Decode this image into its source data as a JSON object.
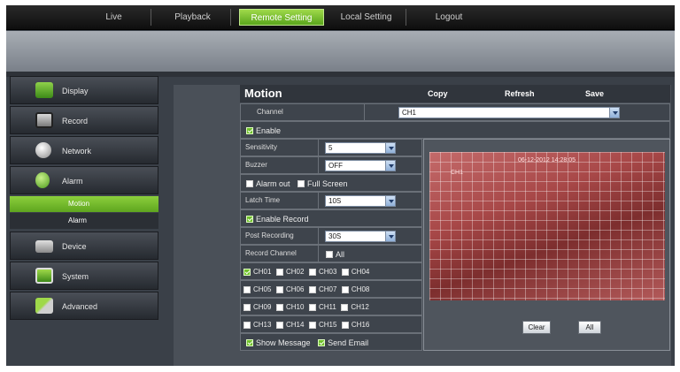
{
  "topbar": {
    "tabs": [
      {
        "label": "Live",
        "active": false
      },
      {
        "label": "Playback",
        "active": false
      },
      {
        "label": "Remote Setting",
        "active": true
      },
      {
        "label": "Local Setting",
        "active": false
      },
      {
        "label": "Logout",
        "active": false
      }
    ]
  },
  "sidebar": {
    "items": [
      {
        "label": "Display",
        "icon": "monitor-icon"
      },
      {
        "label": "Record",
        "icon": "film-icon"
      },
      {
        "label": "Network",
        "icon": "globe-icon"
      },
      {
        "label": "Alarm",
        "icon": "alarm-icon"
      },
      {
        "label": "Device",
        "icon": "hdd-icon"
      },
      {
        "label": "System",
        "icon": "system-icon"
      },
      {
        "label": "Advanced",
        "icon": "tools-icon"
      }
    ],
    "alarm_subitems": [
      {
        "label": "Motion",
        "active": true
      },
      {
        "label": "Alarm",
        "active": false
      }
    ]
  },
  "header": {
    "title": "Motion",
    "copy": "Copy",
    "refresh": "Refresh",
    "save": "Save"
  },
  "form": {
    "channel_label": "Channel",
    "channel_value": "CH1",
    "enable_label": "Enable",
    "enable_checked": true,
    "sensitivity_label": "Sensitivity",
    "sensitivity_value": "5",
    "buzzer_label": "Buzzer",
    "buzzer_value": "OFF",
    "alarm_out_label": "Alarm out",
    "alarm_out_checked": false,
    "full_screen_label": "Full Screen",
    "full_screen_checked": false,
    "latch_time_label": "Latch Time",
    "latch_time_value": "10S",
    "enable_record_label": "Enable Record",
    "enable_record_checked": true,
    "post_recording_label": "Post Recording",
    "post_recording_value": "30S",
    "record_channel_label": "Record Channel",
    "record_channel_all_label": "All",
    "record_channel_all_checked": false,
    "channels": [
      {
        "label": "CH01",
        "checked": true
      },
      {
        "label": "CH02",
        "checked": false
      },
      {
        "label": "CH03",
        "checked": false
      },
      {
        "label": "CH04",
        "checked": false
      },
      {
        "label": "CH05",
        "checked": false
      },
      {
        "label": "CH06",
        "checked": false
      },
      {
        "label": "CH07",
        "checked": false
      },
      {
        "label": "CH08",
        "checked": false
      },
      {
        "label": "CH09",
        "checked": false
      },
      {
        "label": "CH10",
        "checked": false
      },
      {
        "label": "CH11",
        "checked": false
      },
      {
        "label": "CH12",
        "checked": false
      },
      {
        "label": "CH13",
        "checked": false
      },
      {
        "label": "CH14",
        "checked": false
      },
      {
        "label": "CH15",
        "checked": false
      },
      {
        "label": "CH16",
        "checked": false
      }
    ],
    "show_message_label": "Show Message",
    "show_message_checked": true,
    "send_email_label": "Send Email",
    "send_email_checked": true
  },
  "preview": {
    "timestamp": "06-12-2012 14:28:05",
    "camera_label": "CH1",
    "clear_label": "Clear",
    "all_label": "All"
  }
}
